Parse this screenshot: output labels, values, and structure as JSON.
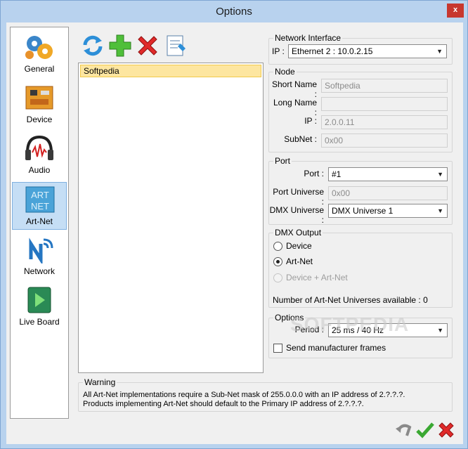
{
  "window": {
    "title": "Options",
    "close_glyph": "x"
  },
  "sidebar": {
    "items": [
      {
        "label": "General",
        "icon": "gears-icon"
      },
      {
        "label": "Device",
        "icon": "circuit-board-icon"
      },
      {
        "label": "Audio",
        "icon": "headphones-icon"
      },
      {
        "label": "Art-Net",
        "icon": "artnet-logo-icon",
        "selected": true
      },
      {
        "label": "Network",
        "icon": "network-icon"
      },
      {
        "label": "Live Board",
        "icon": "play-board-icon"
      }
    ]
  },
  "toolbar": {
    "icons": [
      "refresh-icon",
      "add-icon",
      "delete-icon",
      "edit-document-icon"
    ]
  },
  "list": {
    "items": [
      "Softpedia"
    ]
  },
  "network_interface": {
    "title": "Network Interface",
    "ip_label": "IP :",
    "ip_value": "Ethernet 2 : 10.0.2.15"
  },
  "node": {
    "title": "Node",
    "short_name_label": "Short Name :",
    "short_name_value": "Softpedia",
    "long_name_label": "Long Name :",
    "long_name_value": "",
    "ip_label": "IP :",
    "ip_value": "2.0.0.11",
    "subnet_label": "SubNet :",
    "subnet_value": "0x00"
  },
  "port": {
    "title": "Port",
    "port_label": "Port :",
    "port_value": "#1",
    "universe_label": "Port Universe :",
    "universe_value": "0x00",
    "dmx_universe_label": "DMX Universe :",
    "dmx_universe_value": "DMX Universe 1"
  },
  "dmx_output": {
    "title": "DMX Output",
    "options": [
      {
        "label": "Device",
        "selected": false,
        "enabled": true
      },
      {
        "label": "Art-Net",
        "selected": true,
        "enabled": true
      },
      {
        "label": "Device + Art-Net",
        "selected": false,
        "enabled": false
      }
    ],
    "universes_text": "Number of Art-Net Universes available : 0"
  },
  "options": {
    "title": "Options",
    "period_label": "Period :",
    "period_value": "25 ms / 40 Hz",
    "send_manufacturer_label": "Send manufacturer frames",
    "send_manufacturer_checked": false
  },
  "warning": {
    "title": "Warning",
    "line1": "All Art-Net implementations require a Sub-Net mask of 255.0.0.0 with an IP address of 2.?.?.?.",
    "line2": "Products implementing Art-Net should default to the Primary IP address of 2.?.?.?."
  },
  "watermark": "SOFTPEDIA",
  "bottom_icons": [
    "undo-icon",
    "ok-check-icon",
    "cancel-x-icon"
  ],
  "colors": {
    "selection": "#fde6a0",
    "sidebar_selected": "#c5def5",
    "close": "#c7372f"
  }
}
